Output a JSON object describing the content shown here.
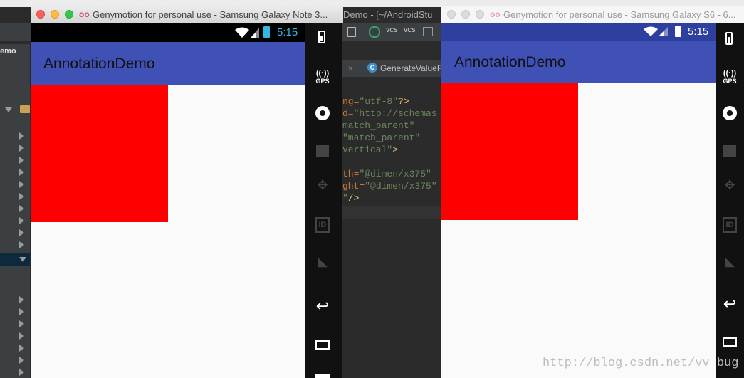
{
  "ide": {
    "project_label": "emo",
    "title": "Demo - [~/AndroidStu",
    "tab_label": "GenerateValueFi",
    "tab_close": "×",
    "tab_icon": "C",
    "vcs1": "VCS",
    "vcs2": "VCS",
    "code_lines": [
      {
        "pre": "ng=",
        "str": "\"utf-8\"",
        "post": "?>"
      },
      {
        "pre": "d=",
        "str": "\"http://schemas",
        "post": ""
      },
      {
        "pre": "",
        "str": "match_parent\"",
        "post": ""
      },
      {
        "pre": "",
        "str": "\"match_parent\"",
        "post": ""
      },
      {
        "pre": "",
        "str": "vertical\"",
        "post": ">"
      },
      {
        "pre": "",
        "str": "",
        "post": ""
      },
      {
        "pre": "th=",
        "str": "\"@dimen/x375\"",
        "post": ""
      },
      {
        "pre": "ght=",
        "str": "\"@dimen/x375\"",
        "post": ""
      },
      {
        "pre": "\"",
        "str": "",
        "post": "/>"
      }
    ]
  },
  "window1": {
    "title": "Genymotion for personal use - Samsung Galaxy Note 3...",
    "logo": "oo",
    "status_time": "5:15",
    "app_title": "AnnotationDemo",
    "red_color": "#ff0000",
    "appbar_color": "#3f51b5",
    "toolbar_icons": [
      "battery-icon",
      "gps-icon",
      "webcam-icon",
      "clapper-icon",
      "dpad-icon",
      "id-icon",
      "cast-icon",
      "back-icon",
      "recent-apps-icon",
      "home-icon"
    ],
    "gps_label": "GPS",
    "id_label": "ID"
  },
  "window2": {
    "title": "Genymotion for personal use - Samsung Galaxy S6 - 6...",
    "logo": "oo",
    "status_time": "5:15",
    "app_title": "AnnotationDemo",
    "red_color": "#ff0000",
    "appbar_color": "#3f51b5",
    "gps_label": "GPS",
    "id_label": "ID"
  },
  "watermark": "http://blog.csdn.net/vv_bug"
}
